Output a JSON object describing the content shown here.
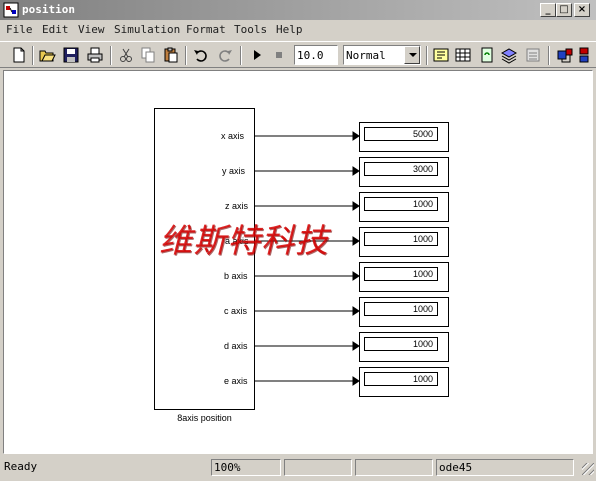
{
  "window": {
    "title": "position",
    "controls": [
      "_",
      "□",
      "×"
    ]
  },
  "menu": [
    "File",
    "Edit",
    "View",
    "Simulation",
    "Format",
    "Tools",
    "Help"
  ],
  "toolbar": {
    "stop_time": "10.0",
    "sim_mode": "Normal",
    "icons": [
      "new-icon",
      "open-icon",
      "save-icon",
      "print-icon",
      "cut-icon",
      "copy-icon",
      "paste-icon",
      "undo-icon",
      "redo-icon",
      "start-icon",
      "stop-icon",
      "build-icon",
      "library-browser-icon",
      "update-diagram-icon",
      "model-explorer-icon",
      "debug-icon",
      "toggle-icon"
    ]
  },
  "diagram": {
    "block_caption": "8axis position",
    "ports": [
      {
        "label": "x  axis",
        "value": "5000"
      },
      {
        "label": "y axis",
        "value": "3000"
      },
      {
        "label": "z axis",
        "value": "1000"
      },
      {
        "label": "a axis",
        "value": "1000"
      },
      {
        "label": "b axis",
        "value": "1000"
      },
      {
        "label": "c axis",
        "value": "1000"
      },
      {
        "label": "d axis",
        "value": "1000"
      },
      {
        "label": "e axis",
        "value": "1000"
      }
    ],
    "watermark": "维斯特科技"
  },
  "status": {
    "state": "Ready",
    "zoom": "100%",
    "blank1": "",
    "blank2": "",
    "solver": "ode45"
  }
}
